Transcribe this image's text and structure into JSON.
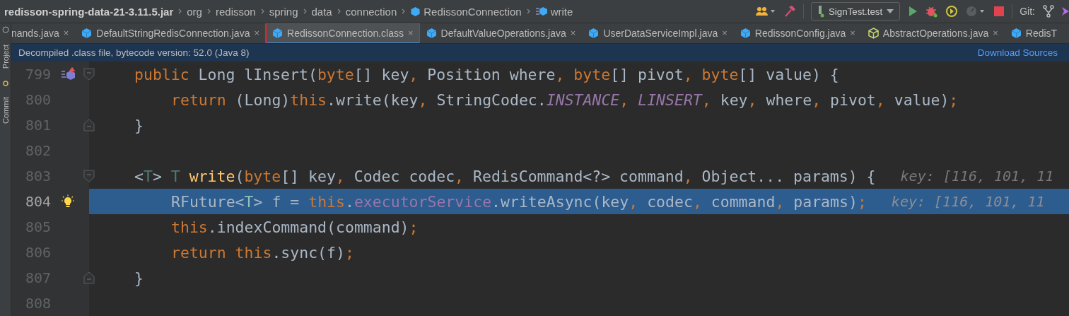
{
  "breadcrumbs": [
    {
      "label": "redisson-spring-data-21-3.11.5.jar",
      "kind": "jar"
    },
    {
      "label": "org",
      "kind": "package"
    },
    {
      "label": "redisson",
      "kind": "package"
    },
    {
      "label": "spring",
      "kind": "package"
    },
    {
      "label": "data",
      "kind": "package"
    },
    {
      "label": "connection",
      "kind": "package"
    },
    {
      "label": "RedissonConnection",
      "kind": "class"
    },
    {
      "label": "write",
      "kind": "method"
    }
  ],
  "toolbar": {
    "run_config": "SignTest.test",
    "git_label": "Git:"
  },
  "side_tabs": [
    {
      "label": "Project"
    },
    {
      "label": "Commit"
    }
  ],
  "tabs": [
    {
      "label": "nands.java",
      "kind": "cut",
      "selected": false,
      "annotated": false,
      "close": "×"
    },
    {
      "label": "DefaultStringRedisConnection.java",
      "kind": "class",
      "selected": false,
      "annotated": false,
      "close": "×"
    },
    {
      "label": "RedissonConnection.class",
      "kind": "class",
      "selected": true,
      "annotated": true,
      "close": "×"
    },
    {
      "label": "DefaultValueOperations.java",
      "kind": "class",
      "selected": false,
      "annotated": false,
      "close": "×"
    },
    {
      "label": "UserDataServiceImpl.java",
      "kind": "class",
      "selected": false,
      "annotated": false,
      "close": "×"
    },
    {
      "label": "RedissonConfig.java",
      "kind": "class",
      "selected": false,
      "annotated": false,
      "close": "×"
    },
    {
      "label": "AbstractOperations.java",
      "kind": "abstract",
      "selected": false,
      "annotated": false,
      "close": "×"
    },
    {
      "label": "RedisT",
      "kind": "class",
      "selected": false,
      "annotated": false
    }
  ],
  "banner": {
    "message": "Decompiled .class file, bytecode version: 52.0 (Java 8)",
    "link": "Download Sources"
  },
  "lines": [
    {
      "number": "799",
      "selected": false,
      "indented": false,
      "marker": {
        "kind": "override"
      },
      "fold": {
        "kind": "start"
      },
      "tokens": [
        {
          "kind": "kw",
          "text": "public "
        },
        {
          "kind": "p",
          "text": "Long lInsert("
        },
        {
          "kind": "kw",
          "text": "byte"
        },
        {
          "kind": "p",
          "text": "[] key"
        },
        {
          "kind": "kw",
          "text": ", "
        },
        {
          "kind": "p",
          "text": "Position where"
        },
        {
          "kind": "kw",
          "text": ", byte"
        },
        {
          "kind": "p",
          "text": "[] pivot"
        },
        {
          "kind": "kw",
          "text": ", byte"
        },
        {
          "kind": "p",
          "text": "[] value) {"
        }
      ]
    },
    {
      "number": "800",
      "selected": false,
      "indented": true,
      "tokens": [
        {
          "kind": "kw",
          "text": "return "
        },
        {
          "kind": "p",
          "text": "(Long)"
        },
        {
          "kind": "kw",
          "text": "this"
        },
        {
          "kind": "p",
          "text": ".write(key"
        },
        {
          "kind": "kw",
          "text": ", "
        },
        {
          "kind": "p",
          "text": "StringCodec."
        },
        {
          "kind": "const",
          "text": "INSTANCE"
        },
        {
          "kind": "kw",
          "text": ", "
        },
        {
          "kind": "const",
          "text": "LINSERT"
        },
        {
          "kind": "kw",
          "text": ", "
        },
        {
          "kind": "p",
          "text": "key"
        },
        {
          "kind": "kw",
          "text": ", "
        },
        {
          "kind": "p",
          "text": "where"
        },
        {
          "kind": "kw",
          "text": ", "
        },
        {
          "kind": "p",
          "text": "pivot"
        },
        {
          "kind": "kw",
          "text": ", "
        },
        {
          "kind": "p",
          "text": "value)"
        },
        {
          "kind": "kw",
          "text": ";"
        }
      ]
    },
    {
      "number": "801",
      "selected": false,
      "indented": false,
      "fold": {
        "kind": "end"
      },
      "tokens": [
        {
          "kind": "p",
          "text": "}"
        }
      ]
    },
    {
      "number": "802",
      "selected": false
    },
    {
      "number": "803",
      "selected": false,
      "indented": false,
      "fold": {
        "kind": "start"
      },
      "tokens": [
        {
          "kind": "p",
          "text": "<"
        },
        {
          "kind": "tp",
          "text": "T"
        },
        {
          "kind": "p",
          "text": "> "
        },
        {
          "kind": "tp",
          "text": "T "
        },
        {
          "kind": "fn",
          "text": "write"
        },
        {
          "kind": "p",
          "text": "("
        },
        {
          "kind": "kw",
          "text": "byte"
        },
        {
          "kind": "p",
          "text": "[] key"
        },
        {
          "kind": "kw",
          "text": ", "
        },
        {
          "kind": "p",
          "text": "Codec codec"
        },
        {
          "kind": "kw",
          "text": ", "
        },
        {
          "kind": "p",
          "text": "RedisCommand<?> command"
        },
        {
          "kind": "kw",
          "text": ", "
        },
        {
          "kind": "p",
          "text": "Object... params) {"
        }
      ],
      "inlay": "key: [116, 101, 11"
    },
    {
      "number": "804",
      "selected": true,
      "indented": true,
      "marker": {
        "kind": "bulb"
      },
      "tokens": [
        {
          "kind": "p",
          "text": "RFuture<"
        },
        {
          "kind": "tp",
          "text": "T"
        },
        {
          "kind": "p",
          "text": "> f = "
        },
        {
          "kind": "kw",
          "text": "this"
        },
        {
          "kind": "p",
          "text": "."
        },
        {
          "kind": "field",
          "text": "executorService"
        },
        {
          "kind": "p",
          "text": ".writeAsync(key"
        },
        {
          "kind": "kw",
          "text": ", "
        },
        {
          "kind": "p",
          "text": "codec"
        },
        {
          "kind": "kw",
          "text": ", "
        },
        {
          "kind": "p",
          "text": "command"
        },
        {
          "kind": "kw",
          "text": ", "
        },
        {
          "kind": "p",
          "text": "params)"
        },
        {
          "kind": "kw",
          "text": ";"
        }
      ],
      "inlay": "key: [116, 101, 11"
    },
    {
      "number": "805",
      "selected": false,
      "indented": true,
      "tokens": [
        {
          "kind": "kw",
          "text": "this"
        },
        {
          "kind": "p",
          "text": ".indexCommand(command)"
        },
        {
          "kind": "kw",
          "text": ";"
        }
      ]
    },
    {
      "number": "806",
      "selected": false,
      "indented": true,
      "tokens": [
        {
          "kind": "kw",
          "text": "return this"
        },
        {
          "kind": "p",
          "text": ".sync(f)"
        },
        {
          "kind": "kw",
          "text": ";"
        }
      ]
    },
    {
      "number": "807",
      "selected": false,
      "indented": false,
      "fold": {
        "kind": "end"
      },
      "tokens": [
        {
          "kind": "p",
          "text": "}"
        }
      ]
    },
    {
      "number": "808",
      "selected": false
    }
  ]
}
